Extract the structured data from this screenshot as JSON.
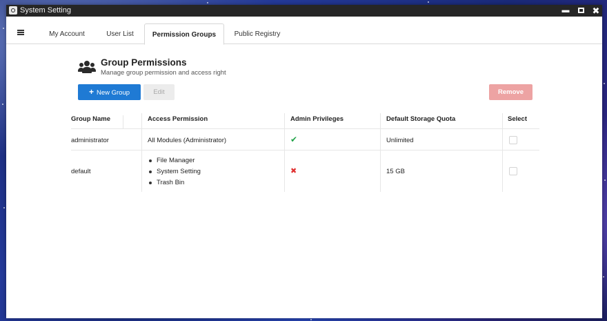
{
  "window": {
    "title": "System Setting"
  },
  "tabs": [
    {
      "label": "My Account"
    },
    {
      "label": "User List"
    },
    {
      "label": "Permission Groups"
    },
    {
      "label": "Public Registry"
    }
  ],
  "active_tab": "Permission Groups",
  "section": {
    "title": "Group Permissions",
    "subtitle": "Manage group permission and access right"
  },
  "toolbar": {
    "new_group_label": "New Group",
    "edit_label": "Edit",
    "remove_label": "Remove"
  },
  "table": {
    "headers": [
      "Group Name",
      "Access Permission",
      "Admin Privileges",
      "Default Storage Quota",
      "Select"
    ],
    "rows": [
      {
        "group_name": "administrator",
        "access": [
          "All Modules (Administrator)"
        ],
        "admin": true,
        "quota": "Unlimited",
        "selected": false
      },
      {
        "group_name": "default",
        "access": [
          "File Manager",
          "System Setting",
          "Trash Bin"
        ],
        "admin": false,
        "quota": "15 GB",
        "selected": false
      }
    ]
  },
  "colors": {
    "primary": "#1f7ad4",
    "danger_disabled": "#eda3a3",
    "check": "#21a348",
    "cross": "#e03030",
    "titlebar": "#262626"
  },
  "icons": {
    "app": "gear-icon",
    "menu": "hamburger-icon",
    "section": "users-group-icon",
    "admin_yes": "check-icon",
    "admin_no": "cross-icon"
  }
}
